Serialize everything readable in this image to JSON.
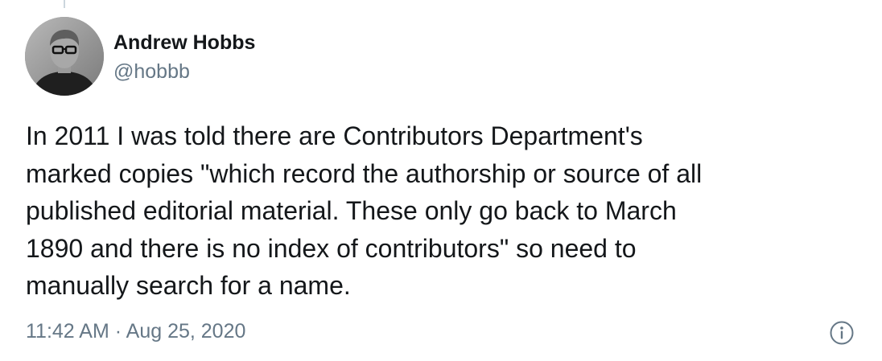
{
  "tweet": {
    "author": {
      "name": "Andrew Hobbs",
      "handle": "@hobbb"
    },
    "text": "In 2011 I was told there are Contributors Department's\nmarked copies \"which record the authorship or source of all\npublished editorial material.  These only go back to March\n1890 and there is no index of contributors\" so need to\nmanually search for a name.",
    "time": "11:42 AM",
    "separator": "·",
    "date": "Aug 25, 2020",
    "info_icon": "info-circle-icon"
  },
  "colors": {
    "text_primary": "#14171a",
    "text_secondary": "#657786",
    "thread_line": "#ccd6dd",
    "background": "#ffffff"
  }
}
